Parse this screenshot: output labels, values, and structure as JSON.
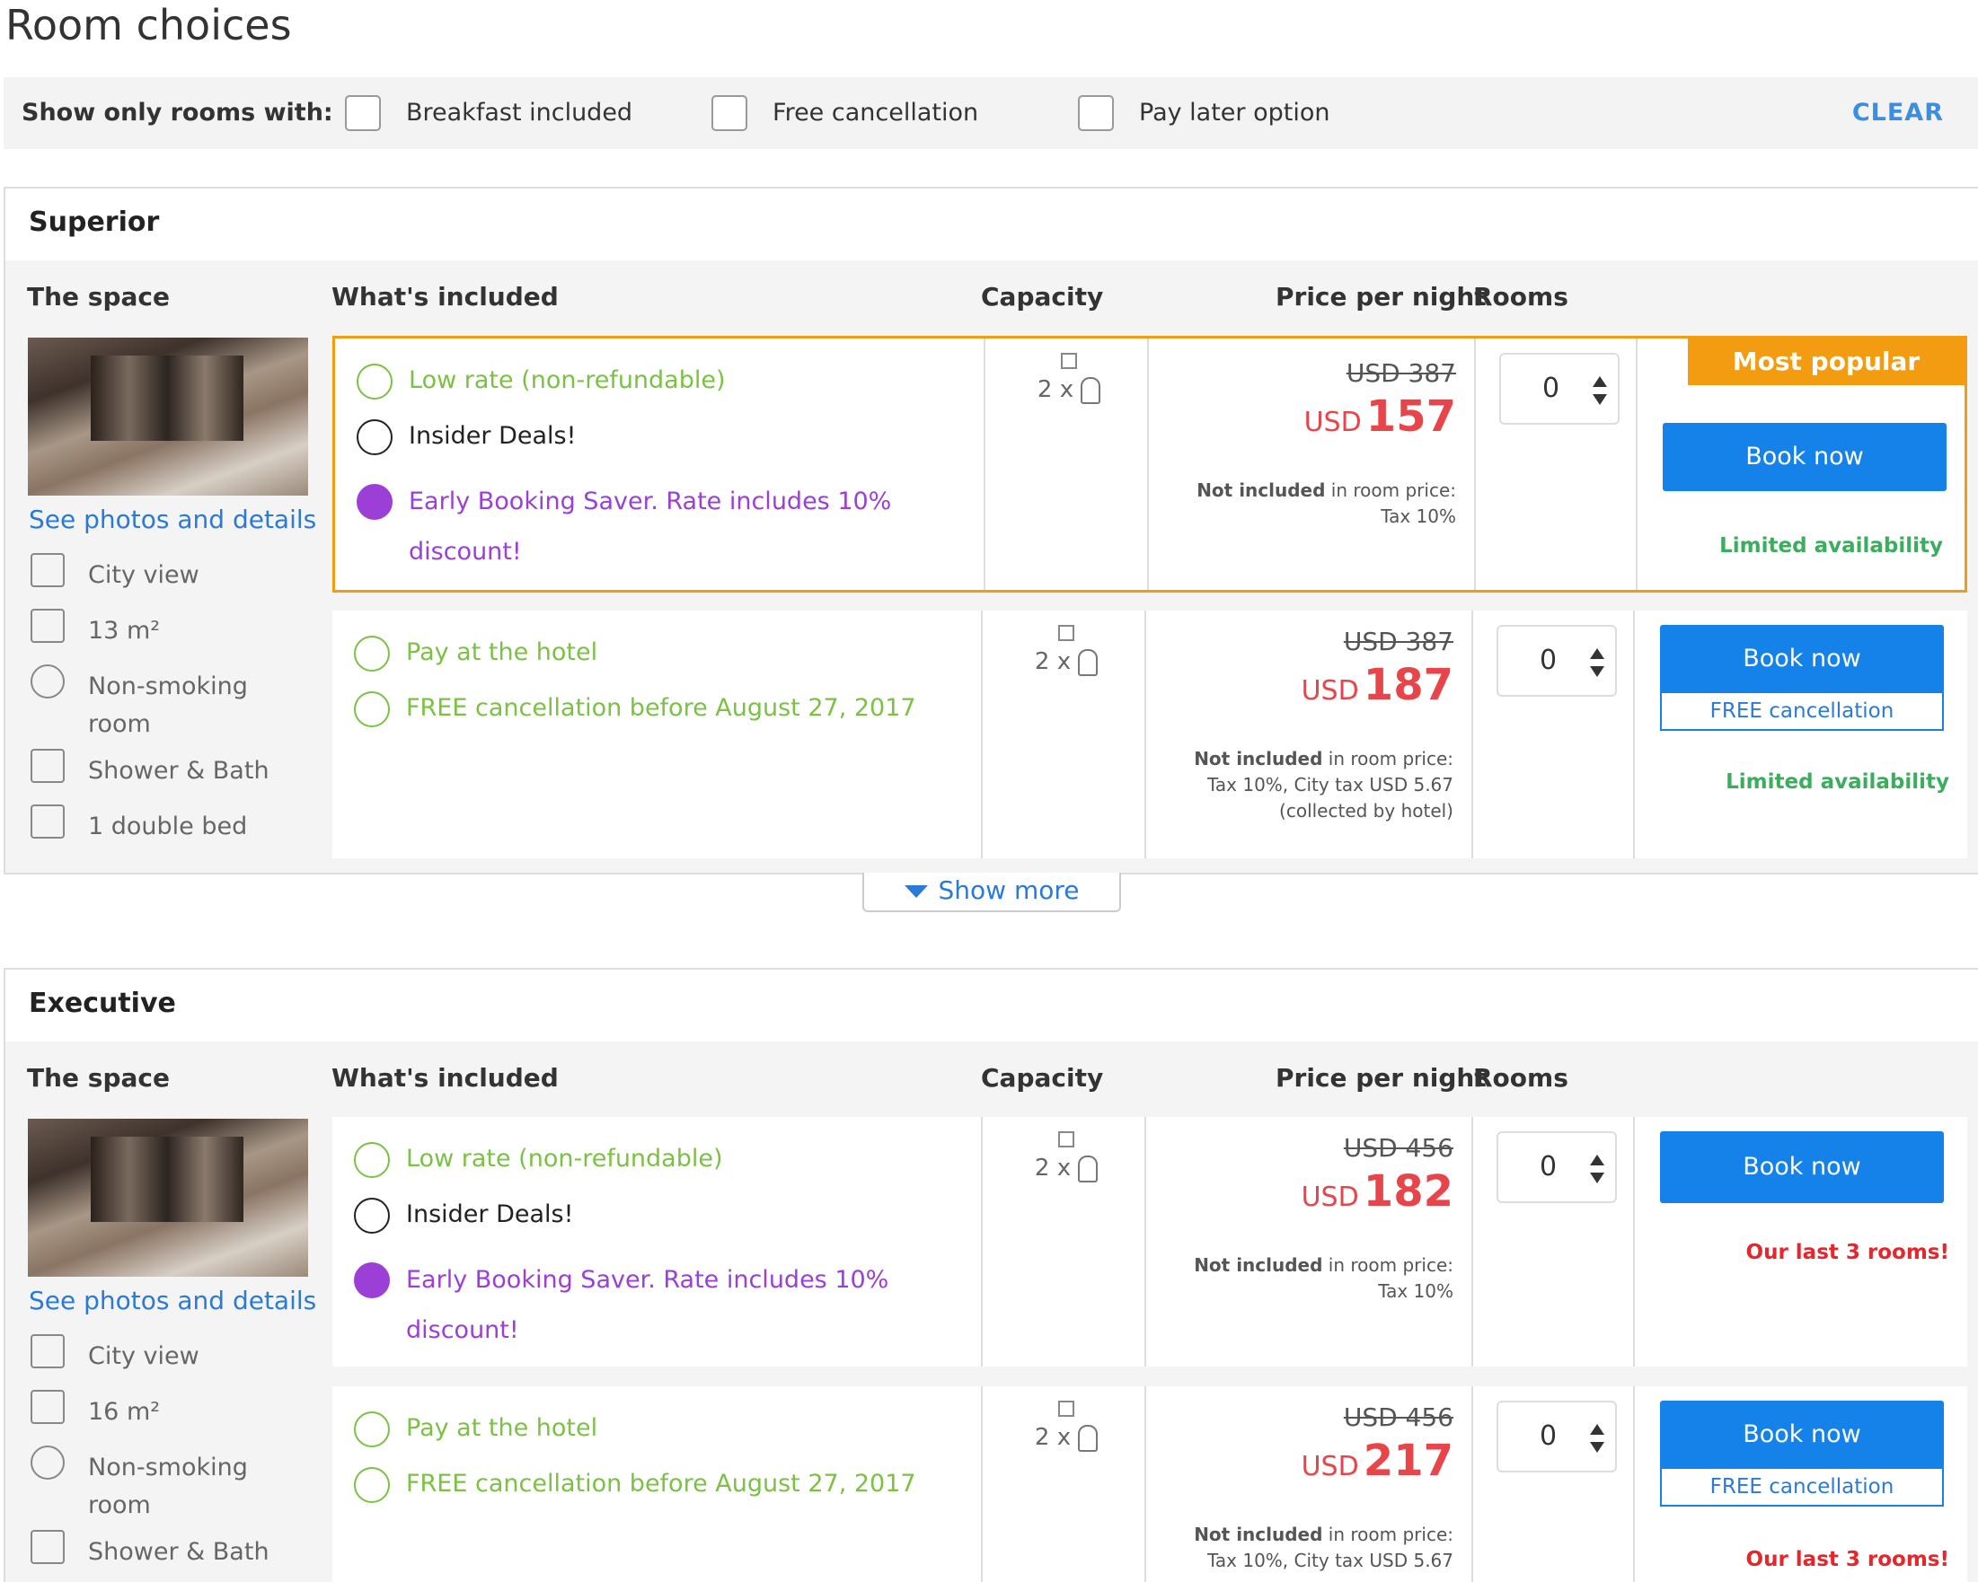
{
  "page": {
    "title": "Room choices"
  },
  "filters": {
    "label": "Show only rooms with:",
    "options": [
      "Breakfast included",
      "Free cancellation",
      "Pay later option"
    ],
    "clear": "CLEAR"
  },
  "columns": [
    "The space",
    "What's included",
    "Capacity",
    "Price per night",
    "Rooms"
  ],
  "show_more": "Show more",
  "rooms": [
    {
      "title": "Superior",
      "see_photos": "See photos and details",
      "features": [
        "City view",
        "13 m²",
        "Non-smoking room",
        "Shower & Bath",
        "1 double bed"
      ],
      "rates": [
        {
          "inclusions": [
            "Low rate (non-refundable)",
            "Insider Deals!",
            "Early Booking Saver. Rate includes 10% discount!"
          ],
          "capacity": "2 x",
          "old_price": "USD 387",
          "currency": "USD",
          "price": "157",
          "tax_label": "Not included",
          "tax_suffix": "in room price:",
          "tax_detail": "Tax 10%",
          "rooms": "0",
          "badge": "Most popular choice!",
          "book": "Book now",
          "availability": "Limited availability"
        },
        {
          "inclusions": [
            "Pay at the hotel",
            "FREE cancellation before August 27, 2017"
          ],
          "capacity": "2 x",
          "old_price": "USD 387",
          "currency": "USD",
          "price": "187",
          "tax_label": "Not included",
          "tax_suffix": "in room price:",
          "tax_detail": "Tax 10%, City tax USD 5.67",
          "tax_detail2": "(collected by hotel)",
          "rooms": "0",
          "book": "Book now",
          "free_cancellation": "FREE cancellation",
          "availability": "Limited availability"
        }
      ]
    },
    {
      "title": "Executive",
      "see_photos": "See photos and details",
      "features": [
        "City view",
        "16 m²",
        "Non-smoking room",
        "Shower & Bath"
      ],
      "rates": [
        {
          "inclusions": [
            "Low rate (non-refundable)",
            "Insider Deals!",
            "Early Booking Saver. Rate includes 10% discount!"
          ],
          "capacity": "2 x",
          "old_price": "USD 456",
          "currency": "USD",
          "price": "182",
          "tax_label": "Not included",
          "tax_suffix": "in room price:",
          "tax_detail": "Tax 10%",
          "rooms": "0",
          "book": "Book now",
          "availability": "Our last 3 rooms!"
        },
        {
          "inclusions": [
            "Pay at the hotel",
            "FREE cancellation before August 27, 2017"
          ],
          "capacity": "2 x",
          "old_price": "USD 456",
          "currency": "USD",
          "price": "217",
          "tax_label": "Not included",
          "tax_suffix": "in room price:",
          "tax_detail": "Tax 10%, City tax USD 5.67",
          "rooms": "0",
          "book": "Book now",
          "free_cancellation": "FREE cancellation",
          "availability": "Our last 3 rooms!"
        }
      ]
    }
  ]
}
